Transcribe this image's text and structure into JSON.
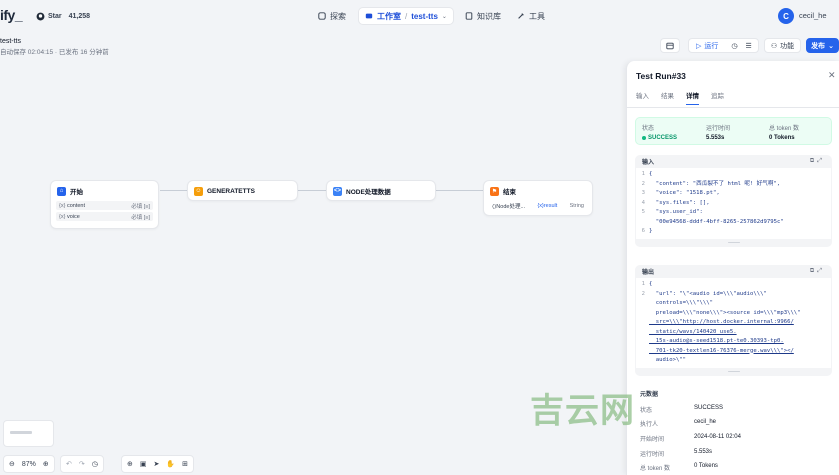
{
  "topbar": {
    "logo": "ify_",
    "github_star_label": "Star",
    "github_star_count": "41,258",
    "nav_explore": "探索",
    "nav_studio": "工作室",
    "nav_app": "test-tts",
    "nav_knowledge": "知识库",
    "nav_tools": "工具",
    "avatar_initial": "C",
    "username": "cecil_he"
  },
  "app": {
    "title": "test-tts",
    "autosave": "自动保存 02:04:15 · 已发布 16 分钟前",
    "run_label": "运行",
    "features_label": "功能",
    "publish_label": "发布"
  },
  "nodes": {
    "start": {
      "title": "开始",
      "rows": [
        {
          "name": "content",
          "req": "必填"
        },
        {
          "name": "voice",
          "req": "必填"
        }
      ]
    },
    "generate": {
      "title": "GENERATETTS"
    },
    "process": {
      "title": "NODE处理数据"
    },
    "end": {
      "title": "结束",
      "var_source": "Node处理...",
      "var_name": "result",
      "var_type": "String"
    }
  },
  "zoom": "87%",
  "panel": {
    "title": "Test Run#33",
    "tabs": [
      "输入",
      "结果",
      "详情",
      "追踪"
    ],
    "active_tab": "详情",
    "status": {
      "status_label": "状态",
      "status_value": "SUCCESS",
      "time_label": "运行时间",
      "time_value": "5.553s",
      "tokens_label": "总 token 数",
      "tokens_value": "0 Tokens"
    },
    "input_title": "输入",
    "input_lines": [
      {
        "n": "1",
        "t": "{"
      },
      {
        "n": "2",
        "t": "  \"content\": \"西瓜裂不了 html 呢! 好气啊\","
      },
      {
        "n": "3",
        "t": "  \"voice\": \"1518.pt\","
      },
      {
        "n": "4",
        "t": "  \"sys.files\": [],"
      },
      {
        "n": "5",
        "t": "  \"sys.user_id\":"
      },
      {
        "n": "",
        "t": "  \"00e94568-dddf-4bff-8265-257862d9795c\""
      },
      {
        "n": "6",
        "t": "}"
      }
    ],
    "output_title": "输出",
    "output_lines": [
      {
        "n": "1",
        "t": "{"
      },
      {
        "n": "2",
        "t": "  \"url\": \"\\\"<audio id=\\\\\\\"audio\\\\\\\""
      },
      {
        "n": "",
        "t": "  controls=\\\\\\\"\\\\\\\""
      },
      {
        "n": "",
        "t": "  preload=\\\\\\\"none\\\\\\\"><source id=\\\\\\\"mp3\\\\\\\""
      },
      {
        "n": "",
        "t": "  src=\\\\\\\"http://host.docker.internal:9966/"
      },
      {
        "n": "",
        "t": "  static/wavs/140420_use5."
      },
      {
        "n": "",
        "t": "  15s-audio@s-seed1518.pt-te0.30393-tp0."
      },
      {
        "n": "",
        "t": "  701-tk20-textlen16-76376-merge.wav\\\\\\\"></"
      },
      {
        "n": "",
        "t": "  audio>\\\"\""
      }
    ],
    "meta_title": "元数据",
    "meta": [
      {
        "k": "状态",
        "v": "SUCCESS"
      },
      {
        "k": "执行人",
        "v": "cecil_he"
      },
      {
        "k": "开始时间",
        "v": "2024-08-11 02:04"
      },
      {
        "k": "运行时间",
        "v": "5.553s"
      },
      {
        "k": "总 token 数",
        "v": "0 Tokens"
      }
    ]
  },
  "watermark": "吉云网",
  "colors": {
    "accent": "#2563eb",
    "success": "#059669",
    "canvas": "#f2f4f7"
  }
}
